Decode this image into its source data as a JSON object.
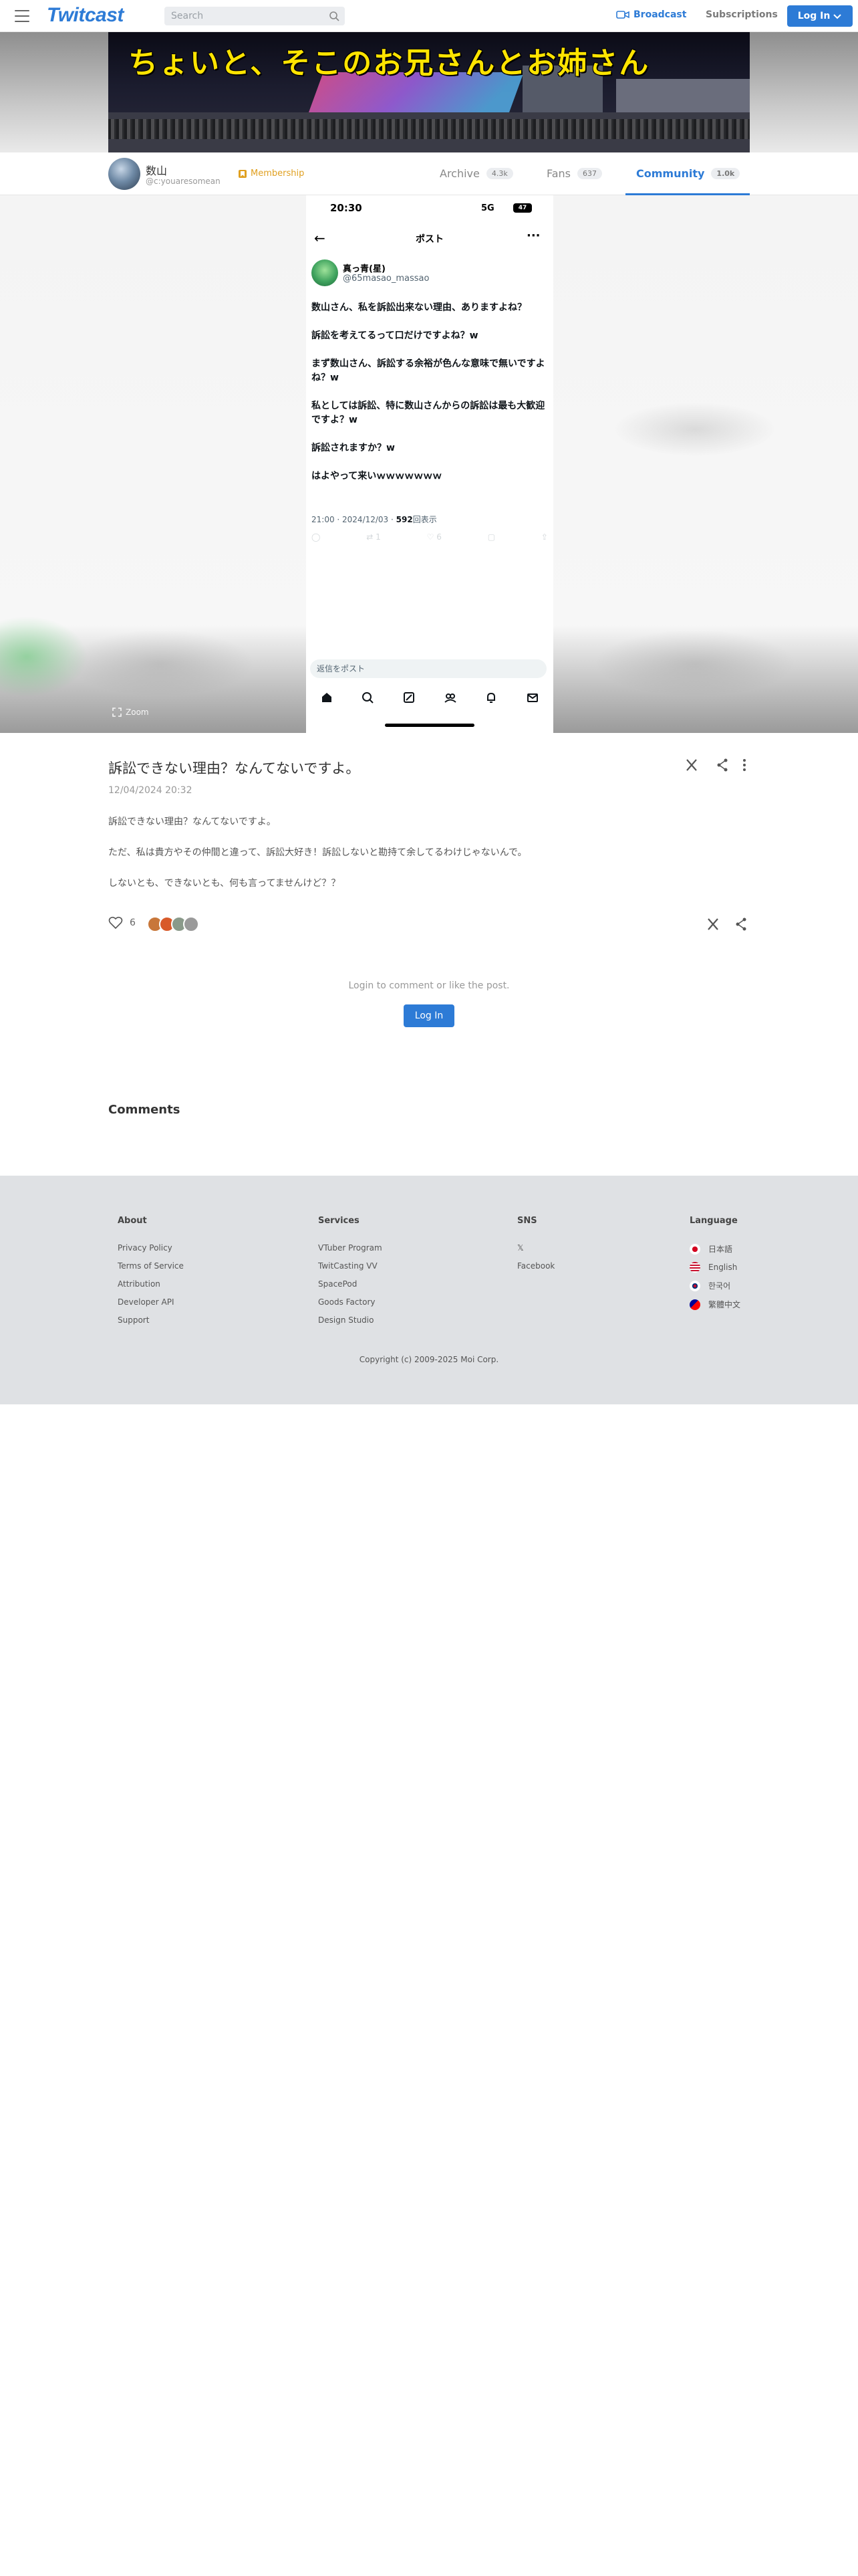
{
  "header": {
    "logo": "Twitcast",
    "search_placeholder": "Search",
    "broadcast_label": "Broadcast",
    "subscriptions_label": "Subscriptions",
    "login_label": "Log In"
  },
  "banner": {
    "title": "ちょいと、そこのお兄さんとお姉さん"
  },
  "profile": {
    "name": "数山",
    "handle": "@c:youaresomean",
    "membership_label": "Membership",
    "tabs": [
      {
        "label": "Archive",
        "count": "4.3k"
      },
      {
        "label": "Fans",
        "count": "637"
      },
      {
        "label": "Community",
        "count": "1.0k"
      }
    ]
  },
  "media": {
    "zoom_label": "Zoom",
    "phone": {
      "time": "20:30",
      "signal": "5G",
      "battery": "47",
      "header_title": "ポスト",
      "author_name": "真っ青(星)",
      "author_handle": "@65masao_massao",
      "body": [
        "数山さん、私を訴訟出来ない理由、ありますよね？",
        "訴訟を考えてるって口だけですよね？w",
        "まず数山さん、訴訟する余裕が色んな意味で無いですよね？w",
        "私としては訴訟、特に数山さんからの訴訟は最も大歓迎ですよ？w",
        "訴訟されますか？w",
        "はよやって来いｗｗｗｗｗｗｗ"
      ],
      "meta_time": "21:00 · 2024/12/03 · ",
      "meta_views": "592",
      "meta_views_label": "回表示",
      "action_counts": [
        "",
        "1",
        "6",
        "",
        ""
      ],
      "reply_placeholder": "返信をポスト"
    }
  },
  "post": {
    "title": "訴訟できない理由？なんてないですよ。",
    "date": "12/04/2024 20:32",
    "body": [
      "訴訟できない理由？なんてないですよ。",
      "ただ、私は貴方やその仲間と違って、訴訟大好き！訴訟しないと勘持て余してるわけじゃないんで。",
      "しないとも、できないとも、何も言ってませんけど？？"
    ],
    "like_count": "6",
    "login_prompt": "Login to comment or like the post.",
    "login_button": "Log In",
    "comments_heading": "Comments"
  },
  "footer": {
    "about": {
      "heading": "About",
      "links": [
        "Privacy Policy",
        "Terms of Service",
        "Attribution",
        "Developer API",
        "Support"
      ]
    },
    "services": {
      "heading": "Services",
      "links": [
        "VTuber Program",
        "TwitCasting VV",
        "SpacePod",
        "Goods Factory",
        "Design Studio"
      ]
    },
    "sns": {
      "heading": "SNS",
      "links": [
        "𝕏",
        "Facebook"
      ]
    },
    "language": {
      "heading": "Language",
      "items": [
        "日本語",
        "English",
        "한국어",
        "繁體中文"
      ]
    },
    "copyright": "Copyright (c) 2009-2025 Moi Corp."
  },
  "colors": {
    "accent": "#2d7bd6",
    "membership": "#e0a020",
    "banner_text": "#ffe400",
    "footer_bg": "#dfe1e4"
  }
}
